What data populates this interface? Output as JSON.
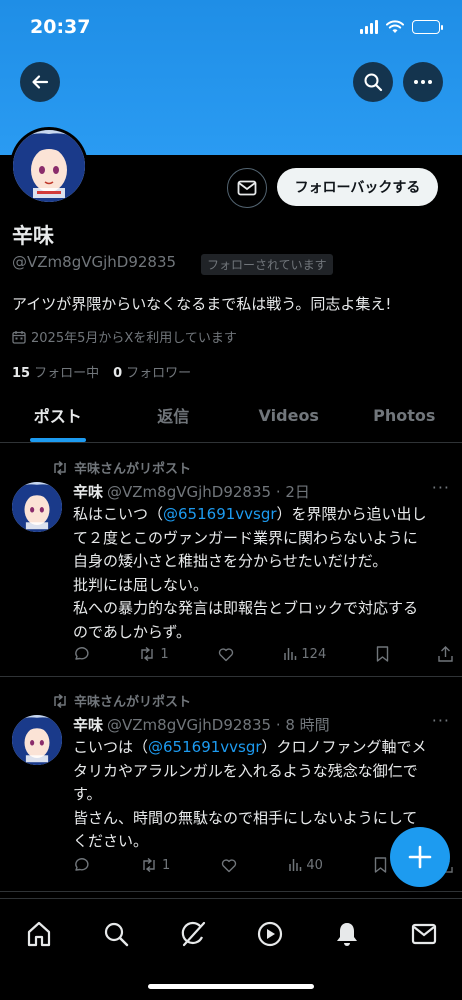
{
  "status_bar": {
    "time": "20:37",
    "battery_level": 0.9
  },
  "profile": {
    "display_name": "辛味",
    "handle": "@VZm8gVGjhD92835",
    "follows_you_badge": "フォローされています",
    "bio": "アイツが界隈からいなくなるまで私は戦う。同志よ集え!",
    "joined": "2025年5月からXを利用しています",
    "following_count": "15",
    "following_label": "フォロー中",
    "followers_count": "0",
    "followers_label": "フォロワー",
    "follow_back_label": "フォローバックする"
  },
  "tabs": [
    {
      "label": "ポスト",
      "active": true
    },
    {
      "label": "返信",
      "active": false
    },
    {
      "label": "Videos",
      "active": false
    },
    {
      "label": "Photos",
      "active": false
    }
  ],
  "tweets": [
    {
      "repost_label": "辛味さんがリポスト",
      "name": "辛味",
      "handle_time": "@VZm8gVGjhD92835 · 2日",
      "lines": [
        {
          "pre": "私はこいつ（",
          "mention": "@651691vvsgr",
          "post": "）を界隈から追い出し"
        },
        {
          "pre": "て２度とこのヴァンガード業界に関わらないように",
          "mention": "",
          "post": ""
        },
        {
          "pre": "自身の矮小さと稚拙さを分からせたいだけだ。",
          "mention": "",
          "post": ""
        },
        {
          "pre": "批判には屈しない。",
          "mention": "",
          "post": ""
        },
        {
          "pre": "私への暴力的な発言は即報告とブロックで対応する",
          "mention": "",
          "post": ""
        },
        {
          "pre": "のであしからず。",
          "mention": "",
          "post": ""
        }
      ],
      "reposts": "1",
      "views": "124"
    },
    {
      "repost_label": "辛味さんがリポスト",
      "name": "辛味",
      "handle_time": "@VZm8gVGjhD92835 · 8 時間",
      "lines": [
        {
          "pre": "こいつは（",
          "mention": "@651691vvsgr",
          "post": "）クロノファング軸でメ"
        },
        {
          "pre": "タリカやアラルンガルを入れるような残念な御仁で",
          "mention": "",
          "post": ""
        },
        {
          "pre": "す。",
          "mention": "",
          "post": ""
        },
        {
          "pre": "皆さん、時間の無駄なので相手にしないようにして",
          "mention": "",
          "post": ""
        },
        {
          "pre": "ください。",
          "mention": "",
          "post": ""
        }
      ],
      "reposts": "1",
      "views": "40"
    }
  ],
  "colors": {
    "banner": "#2a9bf2",
    "accent": "#1d9bf0",
    "text": "#e7e9ea",
    "muted": "#71767b"
  },
  "icons": [
    "back-arrow-icon",
    "search-icon",
    "more-icon",
    "mail-icon",
    "calendar-icon",
    "repost-icon",
    "reply-icon",
    "like-icon",
    "views-icon",
    "bookmark-icon",
    "share-icon",
    "compose-plus-icon",
    "home-icon",
    "explore-icon",
    "grok-icon",
    "video-icon",
    "bell-icon",
    "messages-icon"
  ]
}
